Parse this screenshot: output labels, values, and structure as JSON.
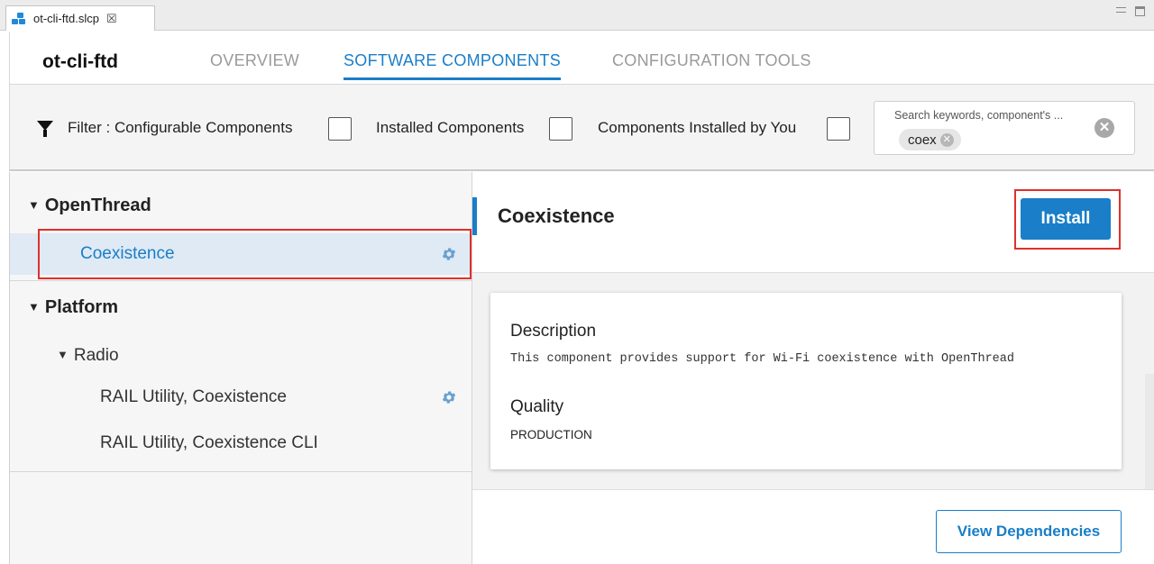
{
  "editor_tab": {
    "file_name": "ot-cli-ftd.slcp",
    "close_glyph": "☒"
  },
  "header": {
    "project_name": "ot-cli-ftd",
    "tabs": [
      {
        "label": "OVERVIEW",
        "active": false
      },
      {
        "label": "SOFTWARE COMPONENTS",
        "active": true
      },
      {
        "label": "CONFIGURATION TOOLS",
        "active": false
      }
    ]
  },
  "filter": {
    "label": "Filter : Configurable Components",
    "installed_label": "Installed Components",
    "installed_by_you_label": "Components Installed by You",
    "configurable_checked": false,
    "installed_checked": false,
    "installed_by_you_checked": false
  },
  "search": {
    "placeholder": "Search keywords, component's ...",
    "chip": "coex",
    "clear_glyph": "✕",
    "chip_x_glyph": "✕"
  },
  "tree": {
    "categories": [
      {
        "label": "OpenThread",
        "items": [
          {
            "label": "Coexistence",
            "selected": true,
            "configurable": true
          }
        ]
      },
      {
        "label": "Platform",
        "subcategory": "Radio",
        "items": [
          {
            "label": "RAIL Utility, Coexistence",
            "configurable": true
          },
          {
            "label": "RAIL Utility, Coexistence CLI",
            "configurable": false
          }
        ]
      }
    ]
  },
  "component": {
    "title": "Coexistence",
    "install_label": "Install",
    "description_heading": "Description",
    "description": "This component provides support for Wi-Fi coexistence with OpenThread",
    "quality_heading": "Quality",
    "quality": "PRODUCTION",
    "view_dependencies_label": "View Dependencies"
  },
  "colors": {
    "accent": "#1a7ec8",
    "highlight": "#e0302a",
    "selected_row": "#dfeaf5"
  }
}
